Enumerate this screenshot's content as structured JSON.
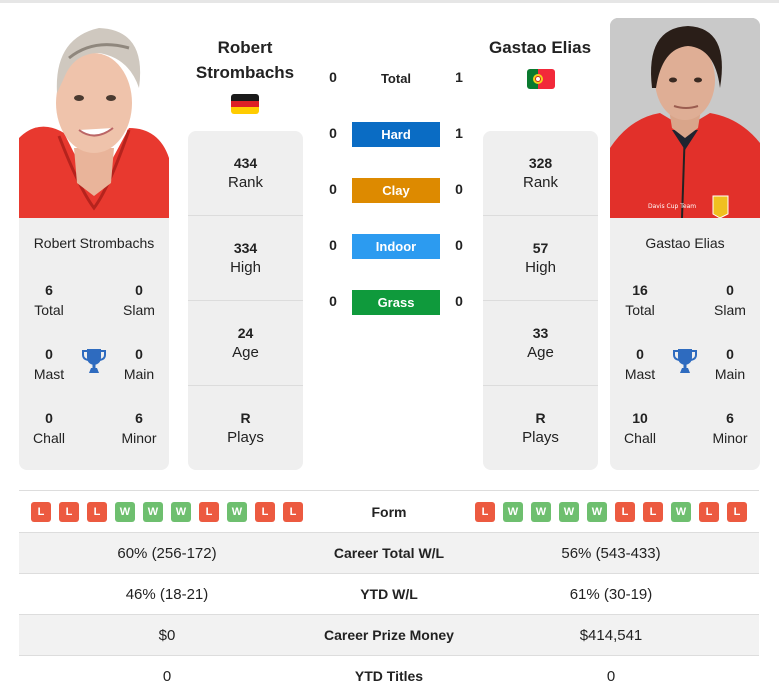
{
  "colors": {
    "hard": "#0a6cc4",
    "clay": "#dd8a00",
    "indoor": "#2c9bf0",
    "grass": "#0f9a3c",
    "win": "#6ebf6f",
    "loss": "#ec5a40",
    "trophy": "#2e6bbf"
  },
  "player1": {
    "name_line1": "Robert",
    "name_line2": "Strombachs",
    "full_name": "Robert Strombachs",
    "flag": "germany-flag",
    "titles": {
      "total": {
        "value": "6",
        "label": "Total"
      },
      "slam": {
        "value": "0",
        "label": "Slam"
      },
      "mast": {
        "value": "0",
        "label": "Mast"
      },
      "main": {
        "value": "0",
        "label": "Main"
      },
      "chall": {
        "value": "0",
        "label": "Chall"
      },
      "minor": {
        "value": "6",
        "label": "Minor"
      }
    },
    "stats": [
      {
        "value": "434",
        "label": "Rank"
      },
      {
        "value": "334",
        "label": "High"
      },
      {
        "value": "24",
        "label": "Age"
      },
      {
        "value": "R",
        "label": "Plays"
      }
    ],
    "form": [
      "L",
      "L",
      "L",
      "W",
      "W",
      "W",
      "L",
      "W",
      "L",
      "L"
    ]
  },
  "player2": {
    "name": "Gastao Elias",
    "full_name": "Gastao Elias",
    "flag": "portugal-flag",
    "titles": {
      "total": {
        "value": "16",
        "label": "Total"
      },
      "slam": {
        "value": "0",
        "label": "Slam"
      },
      "mast": {
        "value": "0",
        "label": "Mast"
      },
      "main": {
        "value": "0",
        "label": "Main"
      },
      "chall": {
        "value": "10",
        "label": "Chall"
      },
      "minor": {
        "value": "6",
        "label": "Minor"
      }
    },
    "stats": [
      {
        "value": "328",
        "label": "Rank"
      },
      {
        "value": "57",
        "label": "High"
      },
      {
        "value": "33",
        "label": "Age"
      },
      {
        "value": "R",
        "label": "Plays"
      }
    ],
    "form": [
      "L",
      "W",
      "W",
      "W",
      "W",
      "L",
      "L",
      "W",
      "L",
      "L"
    ]
  },
  "h2h": [
    {
      "label": "Total",
      "p1": "0",
      "p2": "1"
    },
    {
      "label": "Hard",
      "p1": "0",
      "p2": "1"
    },
    {
      "label": "Clay",
      "p1": "0",
      "p2": "0"
    },
    {
      "label": "Indoor",
      "p1": "0",
      "p2": "0"
    },
    {
      "label": "Grass",
      "p1": "0",
      "p2": "0"
    }
  ],
  "table": {
    "form_label": "Form",
    "rows": [
      {
        "label": "Career Total W/L",
        "p1": "60% (256-172)",
        "p2": "56% (543-433)"
      },
      {
        "label": "YTD W/L",
        "p1": "46% (18-21)",
        "p2": "61% (30-19)"
      },
      {
        "label": "Career Prize Money",
        "p1": "$0",
        "p2": "$414,541"
      },
      {
        "label": "YTD Titles",
        "p1": "0",
        "p2": "0"
      }
    ]
  }
}
